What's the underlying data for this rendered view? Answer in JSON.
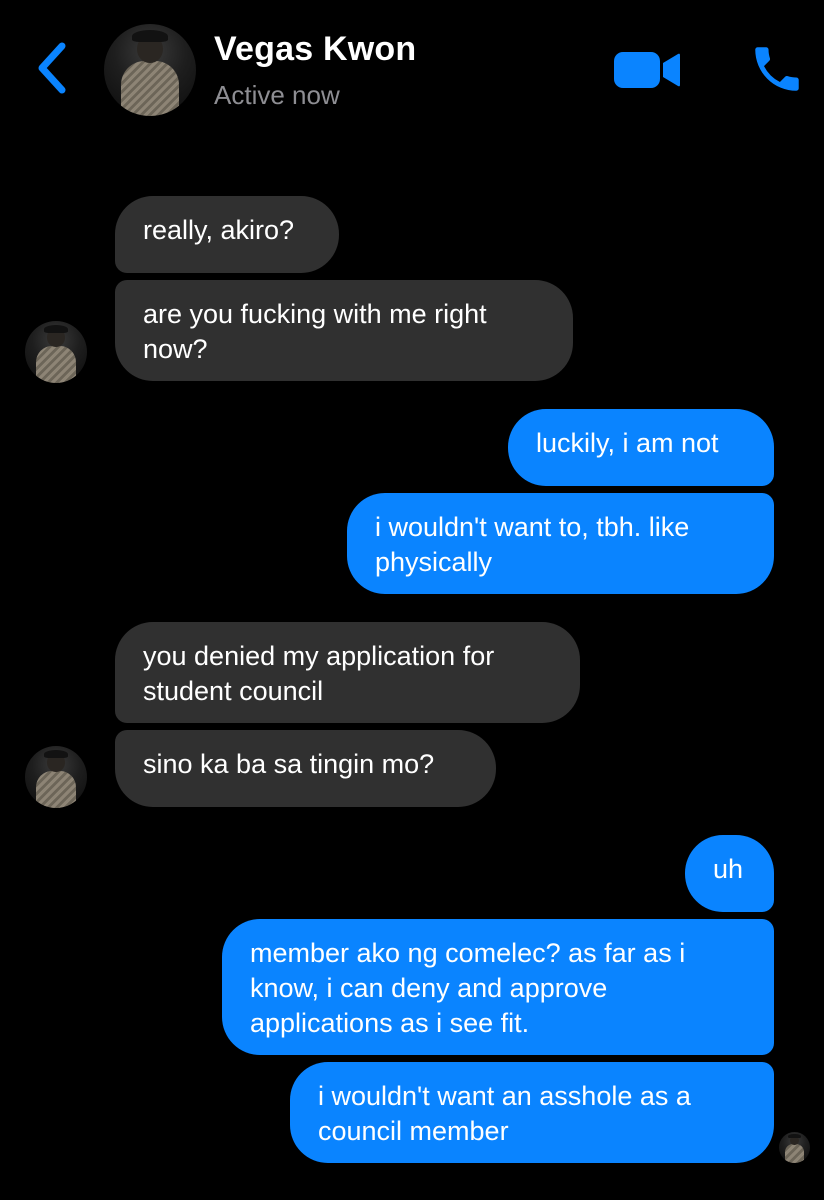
{
  "header": {
    "back_icon": "chevron-left-icon",
    "contact_name": "Vegas Kwon",
    "status": "Active now",
    "video_icon": "video-camera-icon",
    "call_icon": "phone-icon"
  },
  "colors": {
    "background": "#000000",
    "accent": "#0a84ff",
    "incoming_bubble": "#303030",
    "status_text": "#8e8e93"
  },
  "messages": [
    {
      "sender": "contact",
      "text": "really, akiro?"
    },
    {
      "sender": "contact",
      "text": "are you fucking with me right now?"
    },
    {
      "sender": "me",
      "text": "luckily, i am not"
    },
    {
      "sender": "me",
      "text": "i wouldn't want to, tbh. like physically"
    },
    {
      "sender": "contact",
      "text": "you denied my application for student council"
    },
    {
      "sender": "contact",
      "text": "sino ka ba sa tingin mo?"
    },
    {
      "sender": "me",
      "text": "uh"
    },
    {
      "sender": "me",
      "text": "member ako ng comelec? as far as i know, i can deny and approve applications as i see fit."
    },
    {
      "sender": "me",
      "text": "i wouldn't want an asshole as a council member"
    }
  ]
}
